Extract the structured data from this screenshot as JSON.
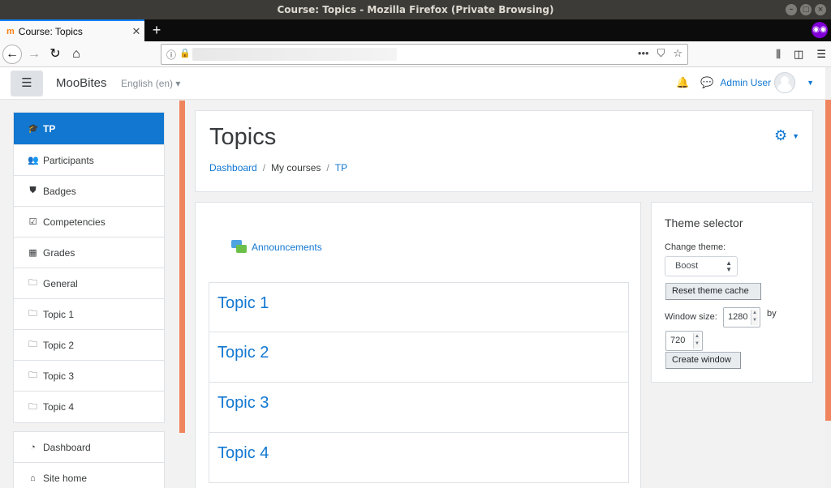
{
  "window": {
    "title": "Course: Topics - Mozilla Firefox (Private Browsing)"
  },
  "browser": {
    "tab_title": "Course: Topics",
    "new_tab": "+",
    "url_actions": [
      "•••"
    ]
  },
  "header": {
    "brand": "MooBites",
    "language": "English (en)",
    "username": "Admin User"
  },
  "nav": {
    "items": [
      {
        "label": "TP",
        "icon": "graduation-cap-icon",
        "active": true
      },
      {
        "label": "Participants",
        "icon": "users-icon"
      },
      {
        "label": "Badges",
        "icon": "shield-icon"
      },
      {
        "label": "Competencies",
        "icon": "check-square-icon"
      },
      {
        "label": "Grades",
        "icon": "table-icon"
      },
      {
        "label": "General",
        "icon": "folder-icon"
      },
      {
        "label": "Topic 1",
        "icon": "folder-icon"
      },
      {
        "label": "Topic 2",
        "icon": "folder-icon"
      },
      {
        "label": "Topic 3",
        "icon": "folder-icon"
      },
      {
        "label": "Topic 4",
        "icon": "folder-icon"
      }
    ],
    "secondary": [
      {
        "label": "Dashboard",
        "icon": "tachometer-icon"
      },
      {
        "label": "Site home",
        "icon": "home-icon"
      }
    ]
  },
  "page": {
    "title": "Topics",
    "breadcrumb": [
      "Dashboard",
      "My courses",
      "TP"
    ]
  },
  "course": {
    "announcements": "Announcements",
    "topics": [
      "Topic 1",
      "Topic 2",
      "Topic 3",
      "Topic 4"
    ]
  },
  "theme_selector": {
    "title": "Theme selector",
    "change_label": "Change theme:",
    "selected_theme": "Boost",
    "reset_label": "Reset theme cache",
    "window_size_label": "Window size:",
    "width": "1280",
    "by_label": "by",
    "height": "720",
    "create_label": "Create window"
  },
  "colors": {
    "brand": "#1177d1",
    "accent": "#f0845d"
  }
}
